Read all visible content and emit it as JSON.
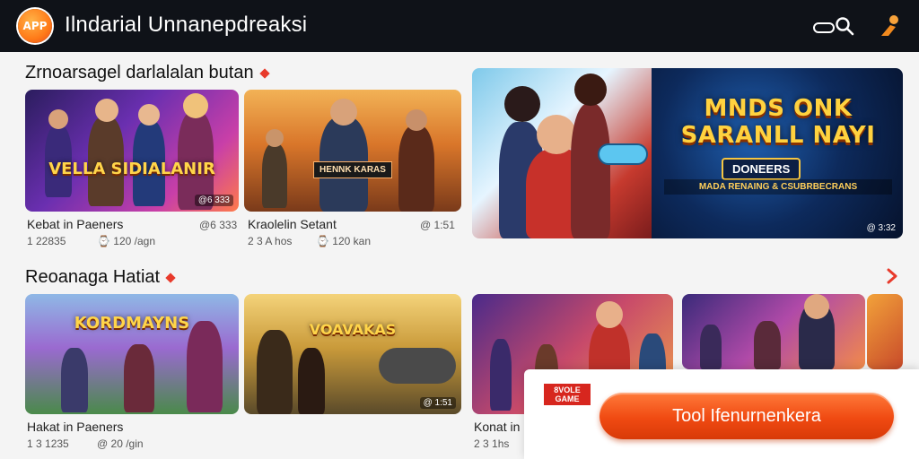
{
  "app": {
    "logo_text": "APP",
    "title": "Ilndarial Unnanepdreaksi"
  },
  "header": {
    "search_icon": "search-icon",
    "profile_icon": "person-icon"
  },
  "section1": {
    "title": "Zrnoarsagel darlalalan butan",
    "cards": [
      {
        "logo": "VELLA SIDIALANIR",
        "badge": "@6 333",
        "title": "Kebat in Paeners",
        "meta_left": "1 22835",
        "meta_right": "120 /agn"
      },
      {
        "banner": "HENNK KARAS",
        "badge": "@ 1:51",
        "title": "Kraolelin Setant",
        "meta_left": "2 3 A hos",
        "meta_right": "120 kan"
      }
    ]
  },
  "featured": {
    "title_line1": "MNDS ONK",
    "title_line2": "SARANLL NAYI",
    "subtitle": "DONEERS",
    "tagline": "MADA RENAING & CSUBRBECRANS",
    "badge": "@ 3:32"
  },
  "section2": {
    "title": "Reoanaga Hatiat",
    "cards": [
      {
        "logo": "KORDMAYNS",
        "title": "Hakat in Paeners",
        "meta_left": "1 3 1235",
        "meta_right": "@ 20 /gin"
      },
      {
        "logo": "VOAVAKAS",
        "badge": "@ 1:51",
        "title": "",
        "meta_left": "",
        "meta_right": ""
      },
      {
        "title": "Konat in",
        "meta_left": "2 3 1hs",
        "meta_right": ""
      },
      {}
    ]
  },
  "install": {
    "logo_text": "8VOLE GAME",
    "button_label": "Tool Ifenurnenkera"
  },
  "colors": {
    "accent": "#f04a12",
    "topbar": "#0f1218",
    "hot": "#e83a2b"
  }
}
